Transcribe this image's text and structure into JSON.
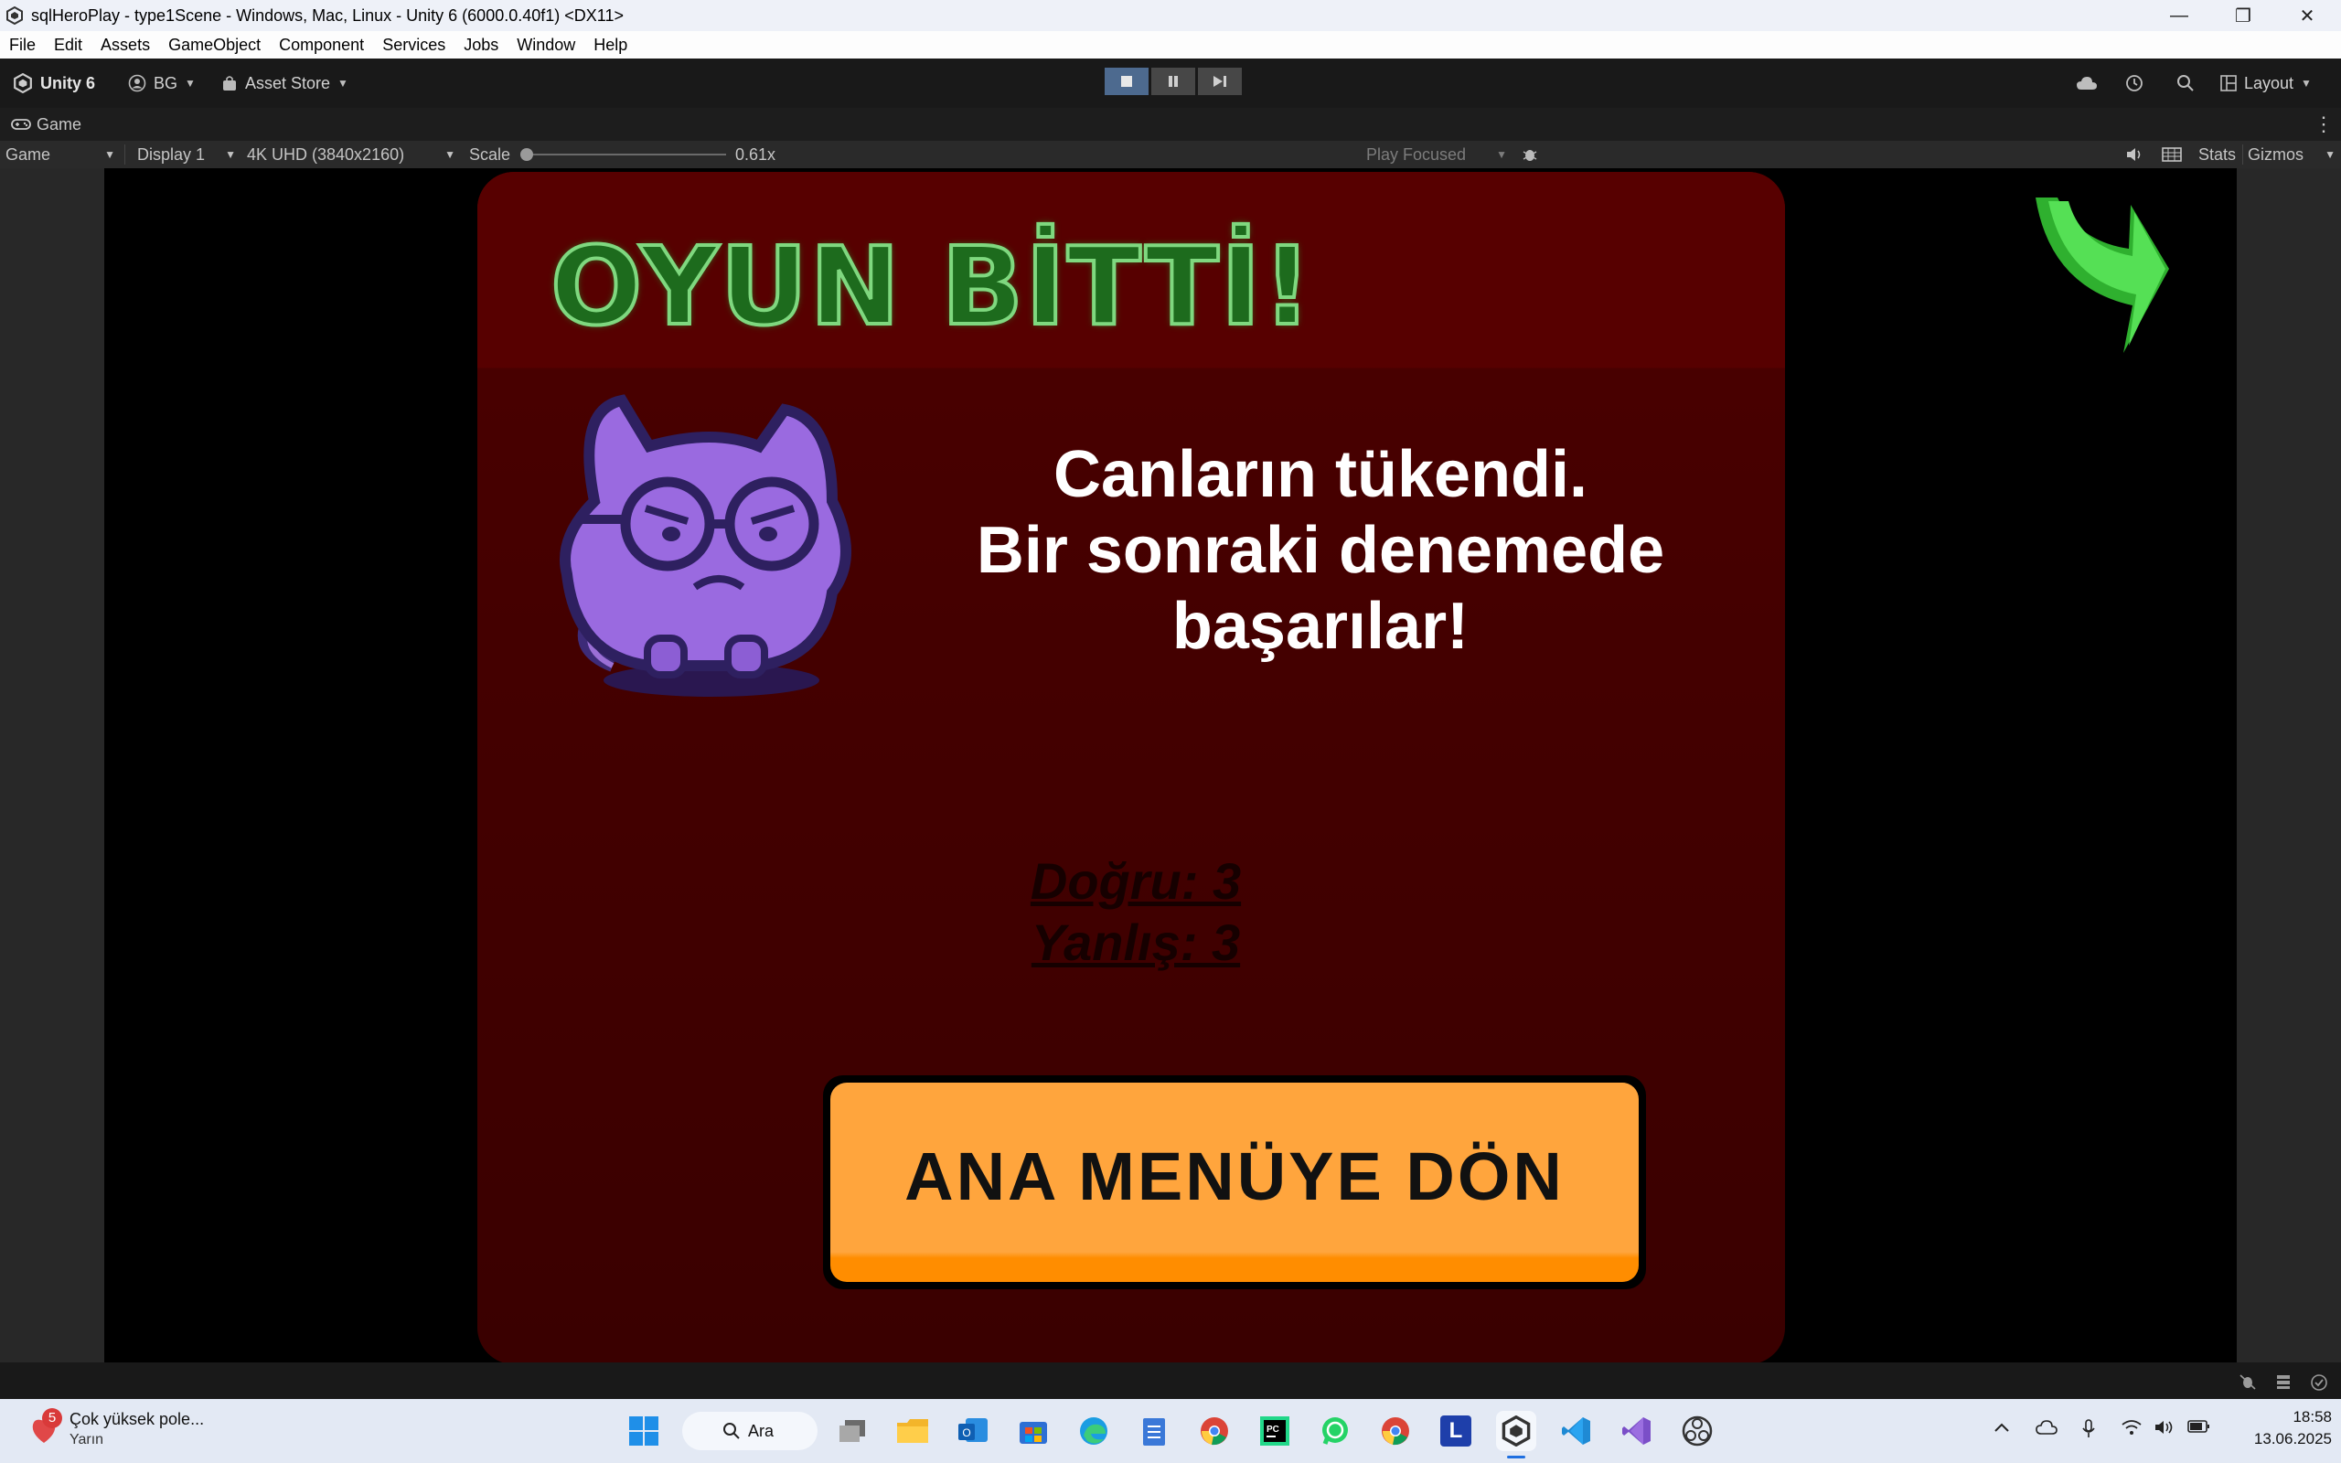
{
  "window": {
    "title": "sqlHeroPlay - type1Scene - Windows, Mac, Linux - Unity 6 (6000.0.40f1) <DX11>",
    "minimize_glyph": "—",
    "restore_glyph": "❐",
    "close_glyph": "✕"
  },
  "menu": [
    "File",
    "Edit",
    "Assets",
    "GameObject",
    "Component",
    "Services",
    "Jobs",
    "Window",
    "Help"
  ],
  "toolbar": {
    "unity_label": "Unity 6",
    "account_label": "BG",
    "asset_store_label": "Asset Store",
    "layout_label": "Layout"
  },
  "tab": {
    "label": "Game",
    "more_glyph": "⋮"
  },
  "game_toolbar": {
    "view_mode": "Game",
    "display": "Display 1",
    "resolution": "4K UHD (3840x2160)",
    "scale_label": "Scale",
    "scale_value": "0.61x",
    "scale_fraction": 0.0,
    "play_mode": "Play Focused",
    "stats_label": "Stats",
    "gizmos_label": "Gizmos"
  },
  "game": {
    "title": "OYUN BİTTİ!",
    "message_lines": [
      "Canların tükendi.",
      "Bir sonraki denemede",
      "başarılar!"
    ],
    "correct": "Doğru: 3",
    "wrong": "Yanlış: 3",
    "button_label": "ANA MENÜYE DÖN"
  },
  "taskbar": {
    "notification_count": "5",
    "weather_title": "Çok yüksek pole...",
    "weather_sub": "Yarın",
    "search_label": "Ara",
    "time": "18:58",
    "date": "13.06.2025",
    "pinned_l_label": "L"
  },
  "colors": {
    "panel_red": "#570000",
    "title_green": "#7fd87f",
    "button_orange": "#ffa53d",
    "arrow_green": "#3fcf3f"
  }
}
